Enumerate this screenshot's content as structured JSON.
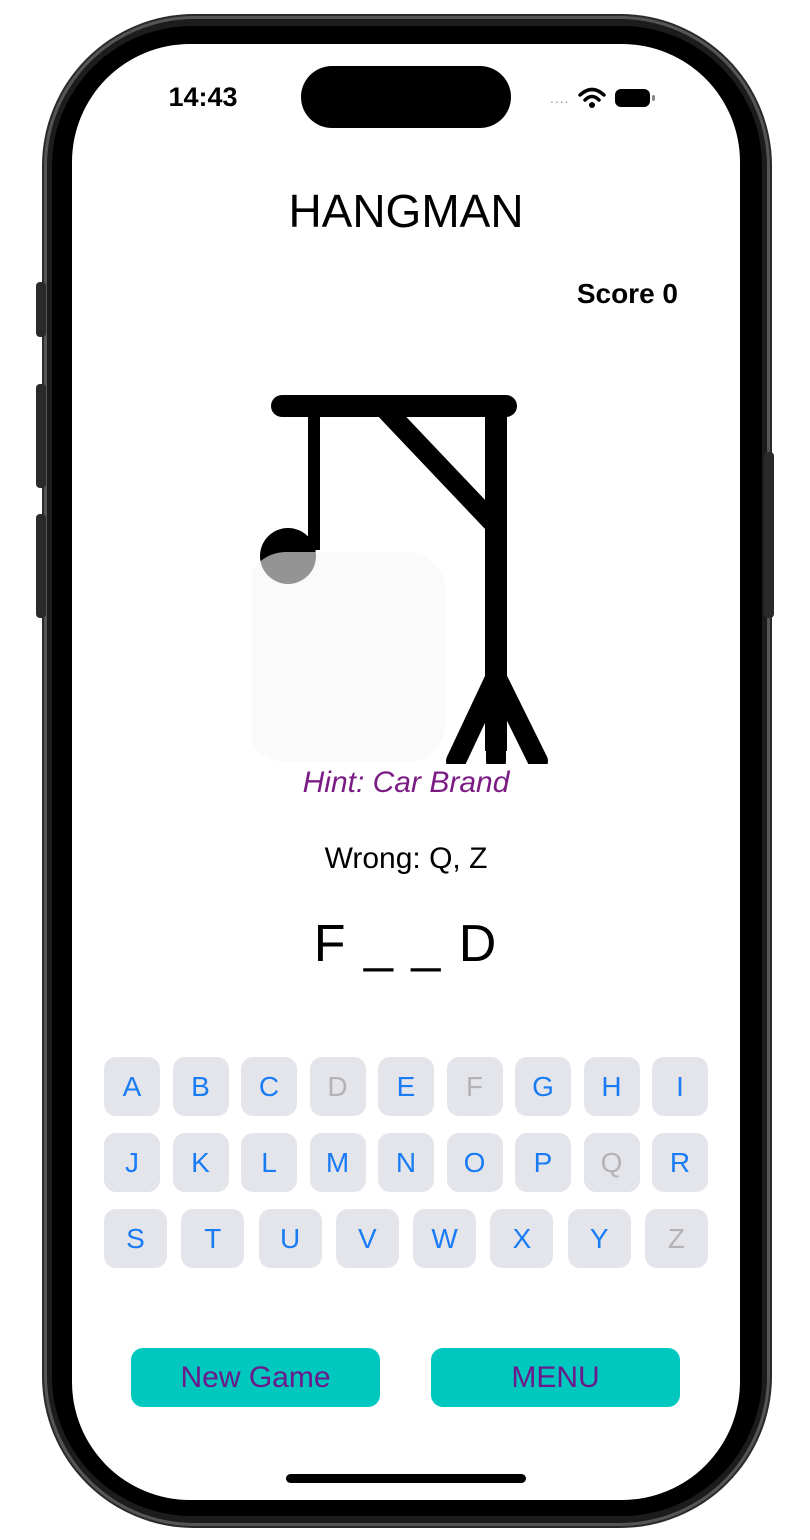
{
  "status_bar": {
    "time": "14:43",
    "signal": "....",
    "wifi_icon": "wifi-icon",
    "battery_icon": "battery-icon"
  },
  "game": {
    "title": "HANGMAN",
    "score": "Score 0",
    "hint": "Hint: Car Brand",
    "wrong": "Wrong: Q, Z",
    "word": "F _ _ D"
  },
  "keyboard": {
    "rows": [
      [
        {
          "label": "A",
          "used": false
        },
        {
          "label": "B",
          "used": false
        },
        {
          "label": "C",
          "used": false
        },
        {
          "label": "D",
          "used": true
        },
        {
          "label": "E",
          "used": false
        },
        {
          "label": "F",
          "used": true
        },
        {
          "label": "G",
          "used": false
        },
        {
          "label": "H",
          "used": false
        },
        {
          "label": "I",
          "used": false
        }
      ],
      [
        {
          "label": "J",
          "used": false
        },
        {
          "label": "K",
          "used": false
        },
        {
          "label": "L",
          "used": false
        },
        {
          "label": "M",
          "used": false
        },
        {
          "label": "N",
          "used": false
        },
        {
          "label": "O",
          "used": false
        },
        {
          "label": "P",
          "used": false
        },
        {
          "label": "Q",
          "used": true
        },
        {
          "label": "R",
          "used": false
        }
      ],
      [
        {
          "label": "S",
          "used": false
        },
        {
          "label": "T",
          "used": false
        },
        {
          "label": "U",
          "used": false
        },
        {
          "label": "V",
          "used": false
        },
        {
          "label": "W",
          "used": false
        },
        {
          "label": "X",
          "used": false
        },
        {
          "label": "Y",
          "used": false
        },
        {
          "label": "Z",
          "used": true
        }
      ]
    ]
  },
  "buttons": {
    "new_game": "New Game",
    "menu": "MENU"
  },
  "colors": {
    "hint": "#7b1b84",
    "key_text": "#1a7cf5",
    "key_used": "#b3b3b6",
    "key_bg": "#e4e5ea",
    "button_bg": "#00c8bf",
    "button_text": "#6a1a8a"
  }
}
